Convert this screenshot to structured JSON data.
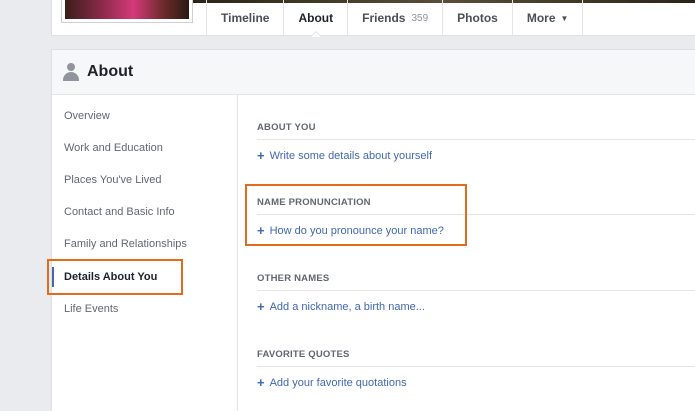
{
  "nav": {
    "tabs": [
      {
        "label": "Timeline"
      },
      {
        "label": "About"
      },
      {
        "label": "Friends",
        "count": "359"
      },
      {
        "label": "Photos"
      },
      {
        "label": "More"
      }
    ]
  },
  "about": {
    "title": "About",
    "sidebar": [
      "Overview",
      "Work and Education",
      "Places You've Lived",
      "Contact and Basic Info",
      "Family and Relationships",
      "Details About You",
      "Life Events"
    ],
    "sections": [
      {
        "title": "ABOUT YOU",
        "link": "Write some details about yourself"
      },
      {
        "title": "NAME PRONUNCIATION",
        "link": "How do you pronounce your name?"
      },
      {
        "title": "OTHER NAMES",
        "link": "Add a nickname, a birth name..."
      },
      {
        "title": "FAVORITE QUOTES",
        "link": "Add your favorite quotations"
      }
    ]
  },
  "colors": {
    "link": "#4267b2",
    "highlight": "#e36b1e"
  }
}
